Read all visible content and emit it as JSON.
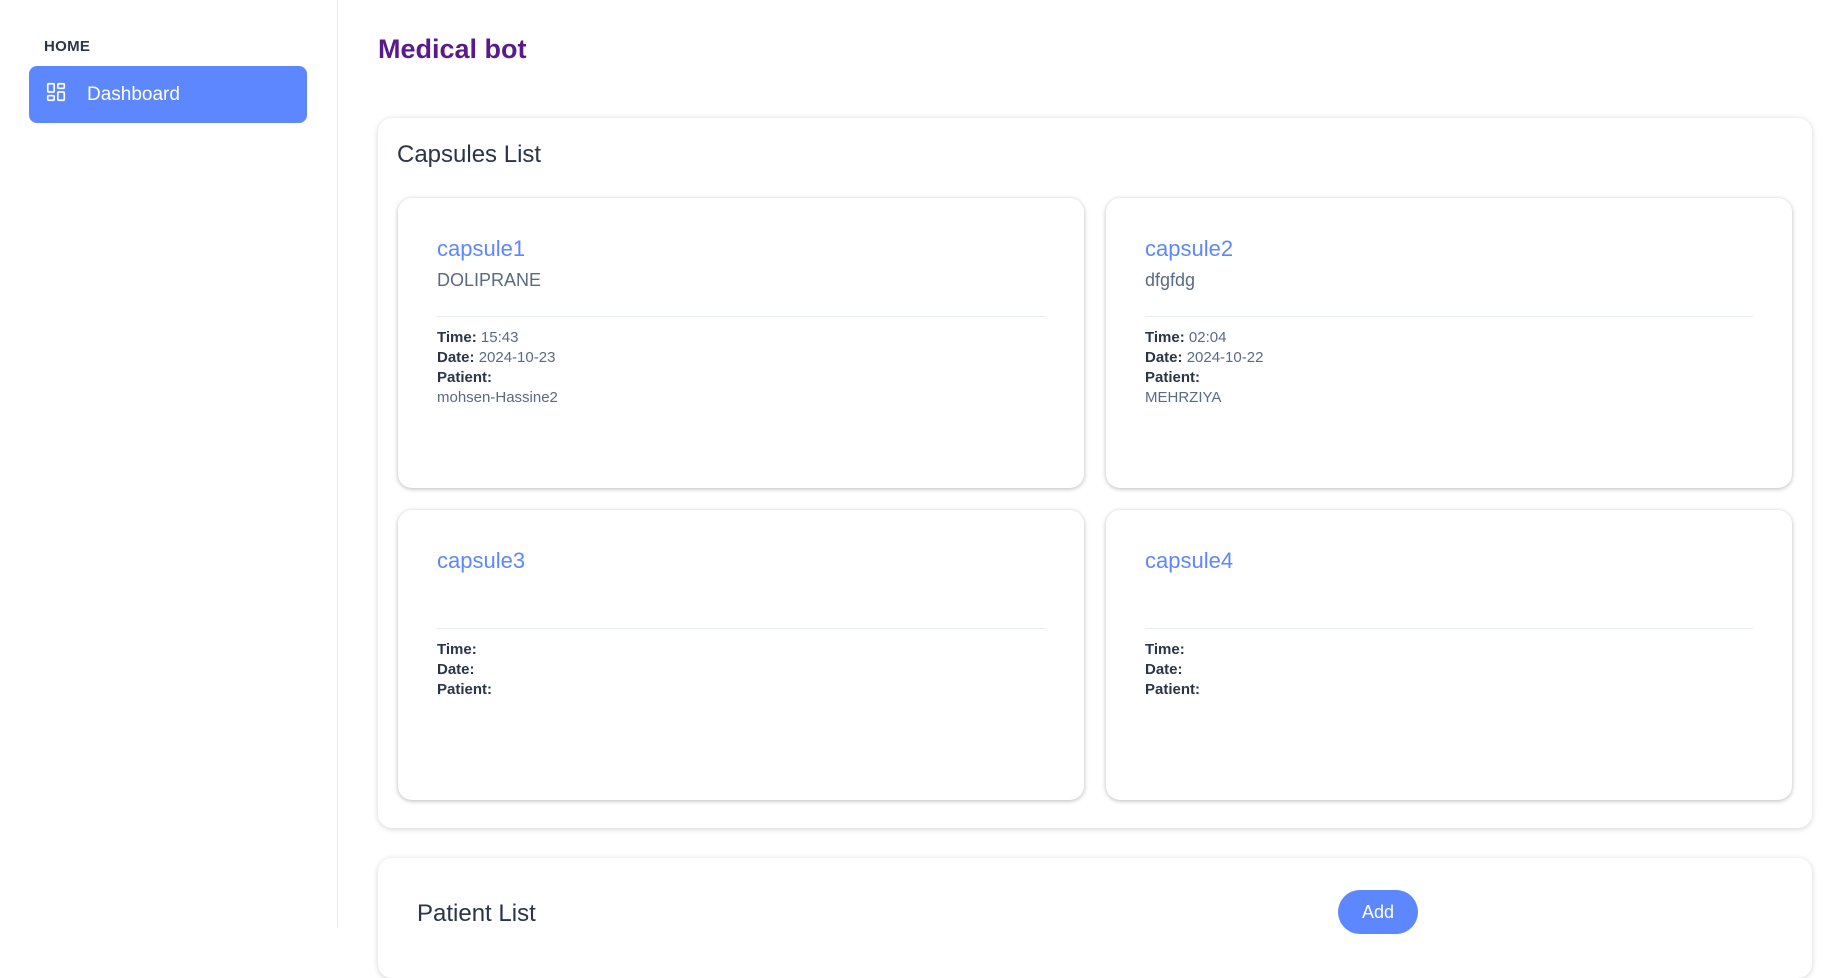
{
  "sidebar": {
    "section_label": "HOME",
    "items": [
      {
        "label": "Dashboard",
        "icon": "dashboard-icon",
        "active": true
      }
    ]
  },
  "header": {
    "title": "Medical bot"
  },
  "capsules": {
    "title": "Capsules List",
    "field_labels": {
      "time": "Time:",
      "date": "Date:",
      "patient": "Patient:"
    },
    "items": [
      {
        "name": "capsule1",
        "medicine": "DOLIPRANE",
        "time": "15:43",
        "date": "2024-10-23",
        "patient": "mohsen-Hassine2"
      },
      {
        "name": "capsule2",
        "medicine": "dfgfdg",
        "time": "02:04",
        "date": "2024-10-22",
        "patient": "MEHRZIYA"
      },
      {
        "name": "capsule3",
        "medicine": "",
        "time": "",
        "date": "",
        "patient": ""
      },
      {
        "name": "capsule4",
        "medicine": "",
        "time": "",
        "date": "",
        "patient": ""
      }
    ]
  },
  "patients": {
    "title": "Patient List",
    "add_label": "Add"
  },
  "colors": {
    "accent": "#5d87ff",
    "brand_title": "#5a1a8c",
    "text_dark": "#2a3547",
    "text_muted": "#5a6a85"
  }
}
